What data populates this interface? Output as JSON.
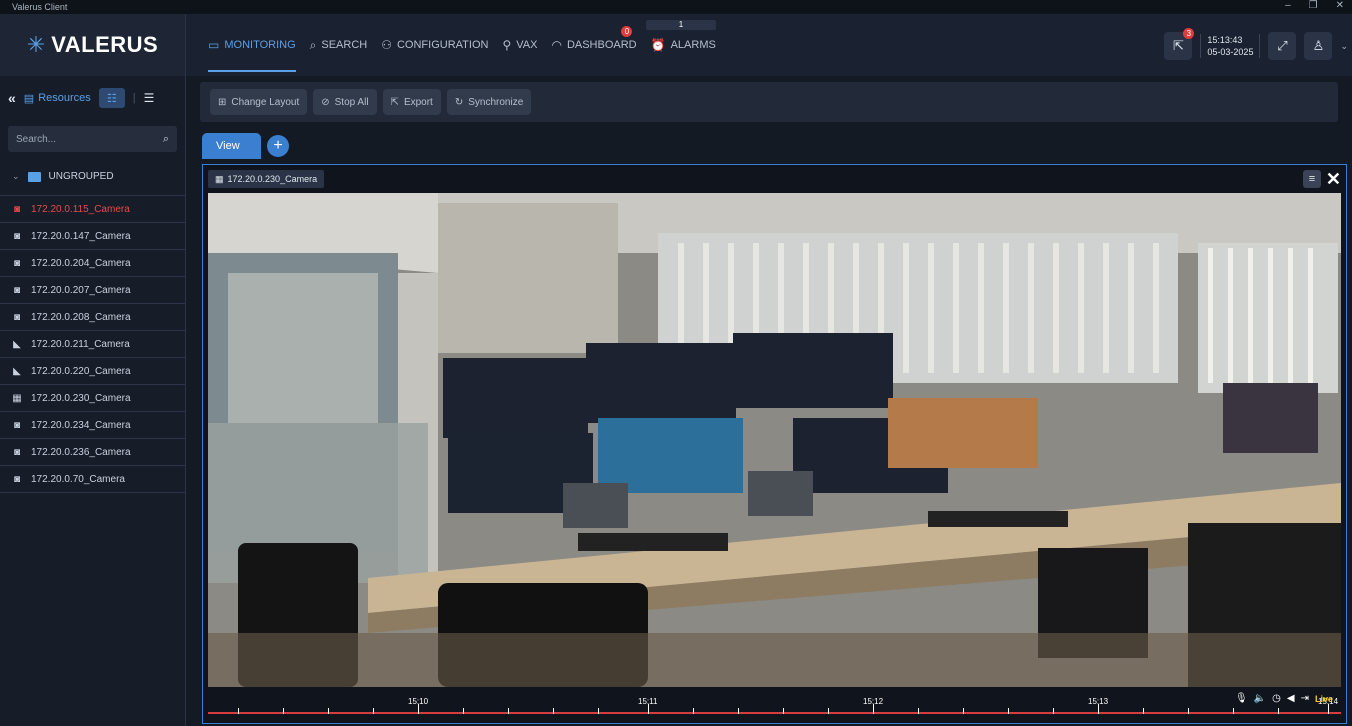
{
  "window": {
    "title": "Valerus Client"
  },
  "header": {
    "logo_text": "VALERUS",
    "nav": [
      {
        "label": "MONITORING",
        "icon": "monitor-icon",
        "active": true
      },
      {
        "label": "SEARCH",
        "icon": "search-icon"
      },
      {
        "label": "CONFIGURATION",
        "icon": "network-icon"
      },
      {
        "label": "VAX",
        "icon": "vax-icon"
      },
      {
        "label": "DASHBOARD",
        "icon": "gauge-icon",
        "badge": "0"
      },
      {
        "label": "ALARMS",
        "icon": "alarm-icon"
      }
    ],
    "tab_counter": "1",
    "export_badge": "3",
    "time": "15:13:43",
    "date": "05-03-2025"
  },
  "sidebar": {
    "resources_label": "Resources",
    "search_placeholder": "Search...",
    "group_label": "UNGROUPED",
    "cameras": [
      {
        "label": "172.20.0.115_Camera",
        "icon": "dome-camera-icon",
        "alert": true
      },
      {
        "label": "172.20.0.147_Camera",
        "icon": "dome-camera-icon"
      },
      {
        "label": "172.20.0.204_Camera",
        "icon": "dome-camera-icon"
      },
      {
        "label": "172.20.0.207_Camera",
        "icon": "dome-camera-icon"
      },
      {
        "label": "172.20.0.208_Camera",
        "icon": "dome-camera-icon"
      },
      {
        "label": "172.20.0.211_Camera",
        "icon": "bullet-camera-icon"
      },
      {
        "label": "172.20.0.220_Camera",
        "icon": "bullet-camera-icon"
      },
      {
        "label": "172.20.0.230_Camera",
        "icon": "encoder-icon"
      },
      {
        "label": "172.20.0.234_Camera",
        "icon": "dome-camera-icon"
      },
      {
        "label": "172.20.0.236_Camera",
        "icon": "dome-camera-icon"
      },
      {
        "label": "172.20.0.70_Camera",
        "icon": "dome-camera-icon"
      }
    ]
  },
  "toolbar": {
    "change_layout": "Change Layout",
    "stop_all": "Stop All",
    "export": "Export",
    "synchronize": "Synchronize"
  },
  "tabs": {
    "view_label": "View",
    "add_label": "+"
  },
  "viewport": {
    "camera_title": "172.20.0.230_Camera",
    "timeline_labels": [
      "15:10",
      "15:11",
      "15:12",
      "15:13",
      "15:14"
    ],
    "live_label": "Live"
  },
  "colors": {
    "accent": "#5aa0e6",
    "alert": "#e84a4a",
    "live": "#f5d020",
    "timeline": "#d83d3d"
  }
}
